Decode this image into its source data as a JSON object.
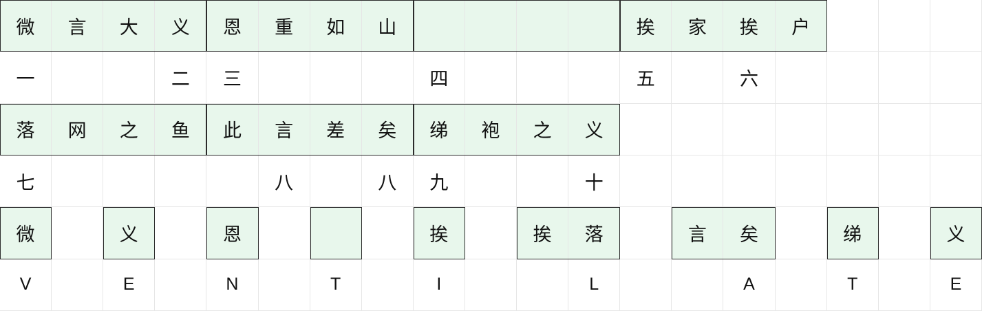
{
  "colors": {
    "filled": "#e8f7ec",
    "grid_line": "#e6e6e6",
    "block_border": "#2b2b2b",
    "text": "#111111"
  },
  "columns": 19,
  "rows": [
    {
      "kind": "idiom",
      "cells": [
        "微",
        "言",
        "大",
        "义",
        "恩",
        "重",
        "如",
        "山",
        "",
        "",
        "",
        "",
        "挨",
        "家",
        "挨",
        "户",
        "",
        "",
        ""
      ],
      "filled": [
        0,
        1,
        2,
        3,
        4,
        5,
        6,
        7,
        8,
        9,
        10,
        11,
        12,
        13,
        14,
        15
      ],
      "blocks": [
        [
          0,
          4
        ],
        [
          4,
          8
        ],
        [
          8,
          12
        ],
        [
          12,
          16
        ]
      ]
    },
    {
      "kind": "label",
      "cells": [
        "一",
        "",
        "",
        "二",
        "三",
        "",
        "",
        "",
        "四",
        "",
        "",
        "",
        "五",
        "",
        "六",
        "",
        "",
        "",
        ""
      ]
    },
    {
      "kind": "idiom",
      "cells": [
        "落",
        "网",
        "之",
        "鱼",
        "此",
        "言",
        "差",
        "矣",
        "绨",
        "袍",
        "之",
        "义",
        "",
        "",
        "",
        "",
        "",
        "",
        ""
      ],
      "filled": [
        0,
        1,
        2,
        3,
        4,
        5,
        6,
        7,
        8,
        9,
        10,
        11
      ],
      "blocks": [
        [
          0,
          4
        ],
        [
          4,
          8
        ],
        [
          8,
          12
        ]
      ]
    },
    {
      "kind": "label",
      "cells": [
        "七",
        "",
        "",
        "",
        "",
        "八",
        "",
        "八",
        "九",
        "",
        "",
        "十",
        "",
        "",
        "",
        "",
        "",
        "",
        ""
      ]
    },
    {
      "kind": "answer",
      "cells": [
        "微",
        "",
        "义",
        "",
        "恩",
        "",
        "",
        "",
        "挨",
        "",
        "挨",
        "落",
        "",
        "言",
        "矣",
        "",
        "绨",
        "",
        "义"
      ],
      "filled": [
        0,
        2,
        4,
        6,
        8,
        10,
        11,
        13,
        14,
        16,
        18
      ],
      "blocks": [
        [
          0,
          1
        ],
        [
          2,
          3
        ],
        [
          4,
          5
        ],
        [
          6,
          7
        ],
        [
          8,
          9
        ],
        [
          10,
          12
        ],
        [
          13,
          15
        ],
        [
          16,
          17
        ],
        [
          18,
          19
        ]
      ]
    },
    {
      "kind": "letters",
      "cells": [
        "V",
        "",
        "E",
        "",
        "N",
        "",
        "T",
        "",
        "I",
        "",
        "",
        "L",
        "",
        "",
        "A",
        "",
        "T",
        "",
        "E"
      ],
      "letter_offset": [
        0,
        0,
        0,
        0,
        0,
        0,
        0,
        0,
        0,
        0,
        0,
        0,
        0,
        0,
        0,
        0,
        0,
        0,
        0
      ]
    }
  ]
}
